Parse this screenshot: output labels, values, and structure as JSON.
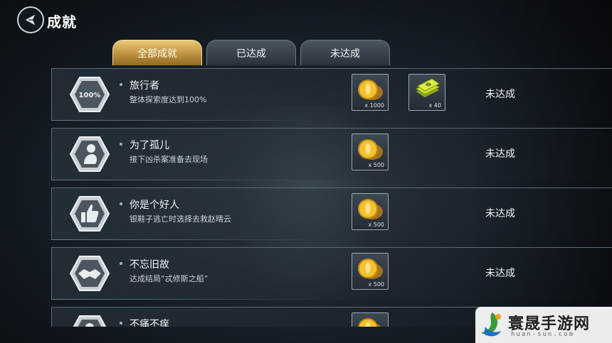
{
  "header": {
    "title": "成就"
  },
  "tabs": [
    {
      "label": "全部成就",
      "active": true
    },
    {
      "label": "已达成",
      "active": false
    },
    {
      "label": "未达成",
      "active": false
    }
  ],
  "achievements": [
    {
      "name": "旅行者",
      "desc": "整体探索度达到100%",
      "badge": "100%",
      "rewards": [
        {
          "icon": "gold-coin-icon",
          "qty": "x 1000"
        },
        {
          "icon": "cash-stack-icon",
          "qty": "x 40"
        }
      ],
      "status": "未达成"
    },
    {
      "name": "为了孤儿",
      "desc": "接下凶杀案准备去现场",
      "badge": "figure-icon",
      "rewards": [
        {
          "icon": "gold-coin-icon",
          "qty": "x 500"
        }
      ],
      "status": "未达成"
    },
    {
      "name": "你是个好人",
      "desc": "银鞋子逃亡时选择去救赵晴云",
      "badge": "thumbs-up-icon",
      "rewards": [
        {
          "icon": "gold-coin-icon",
          "qty": "x 500"
        }
      ],
      "status": "未达成"
    },
    {
      "name": "不忘旧故",
      "desc": "达成结局“忒修斯之船”",
      "badge": "handshake-icon",
      "rewards": [
        {
          "icon": "gold-coin-icon",
          "qty": "x 500"
        }
      ],
      "status": "未达成"
    },
    {
      "name": "不痛不痒",
      "desc": "",
      "badge": "figure-icon",
      "rewards": [
        {
          "icon": "gold-coin-icon",
          "qty": ""
        }
      ],
      "status": ""
    }
  ],
  "watermark": {
    "name": "寰晟手游网",
    "url": "huan-sun.com"
  }
}
